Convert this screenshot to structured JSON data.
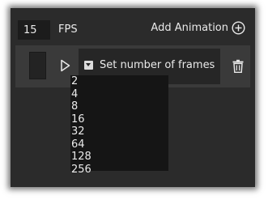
{
  "fps": {
    "value": "15",
    "label": "FPS"
  },
  "add_animation": {
    "label": "Add Animation",
    "icon": "plus-circle-icon"
  },
  "animation_row": {
    "play_icon": "play-icon",
    "dropdown": {
      "selected_label": "Set number of frames",
      "arrow_icon": "chevron-down-icon",
      "options": [
        "2",
        "4",
        "8",
        "16",
        "32",
        "64",
        "128",
        "256"
      ]
    },
    "delete_icon": "trash-icon"
  },
  "colors": {
    "panel_background": "#2b2b2b",
    "row_background": "#3a3a3a",
    "dropdown_background": "#262626",
    "menu_background": "#151515",
    "text": "#eaeaea"
  }
}
